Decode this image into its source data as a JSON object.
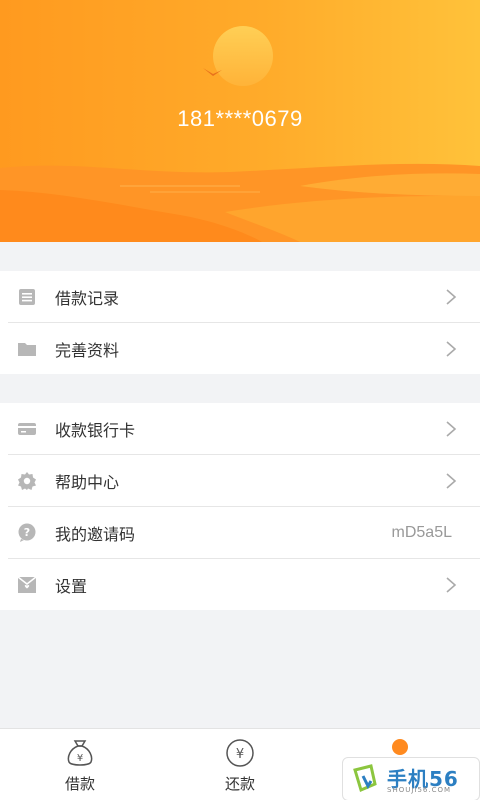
{
  "header": {
    "phone": "181****0679"
  },
  "menu_group1": [
    {
      "label": "借款记录",
      "icon": "list-icon"
    },
    {
      "label": "完善资料",
      "icon": "folder-icon"
    }
  ],
  "menu_group2": [
    {
      "label": "收款银行卡",
      "icon": "card-icon"
    },
    {
      "label": "帮助中心",
      "icon": "gear-icon"
    },
    {
      "label": "我的邀请码",
      "icon": "question-icon",
      "value": "mD5a5L"
    },
    {
      "label": "设置",
      "icon": "settings-box-icon"
    }
  ],
  "tabbar": {
    "tab1": "借款",
    "tab2": "还款"
  },
  "watermark": {
    "text": "手机56",
    "sub": "SHOUJI56.COM"
  },
  "colors": {
    "accent": "#ff9a1f",
    "icon_gray": "#b7b7b7"
  }
}
